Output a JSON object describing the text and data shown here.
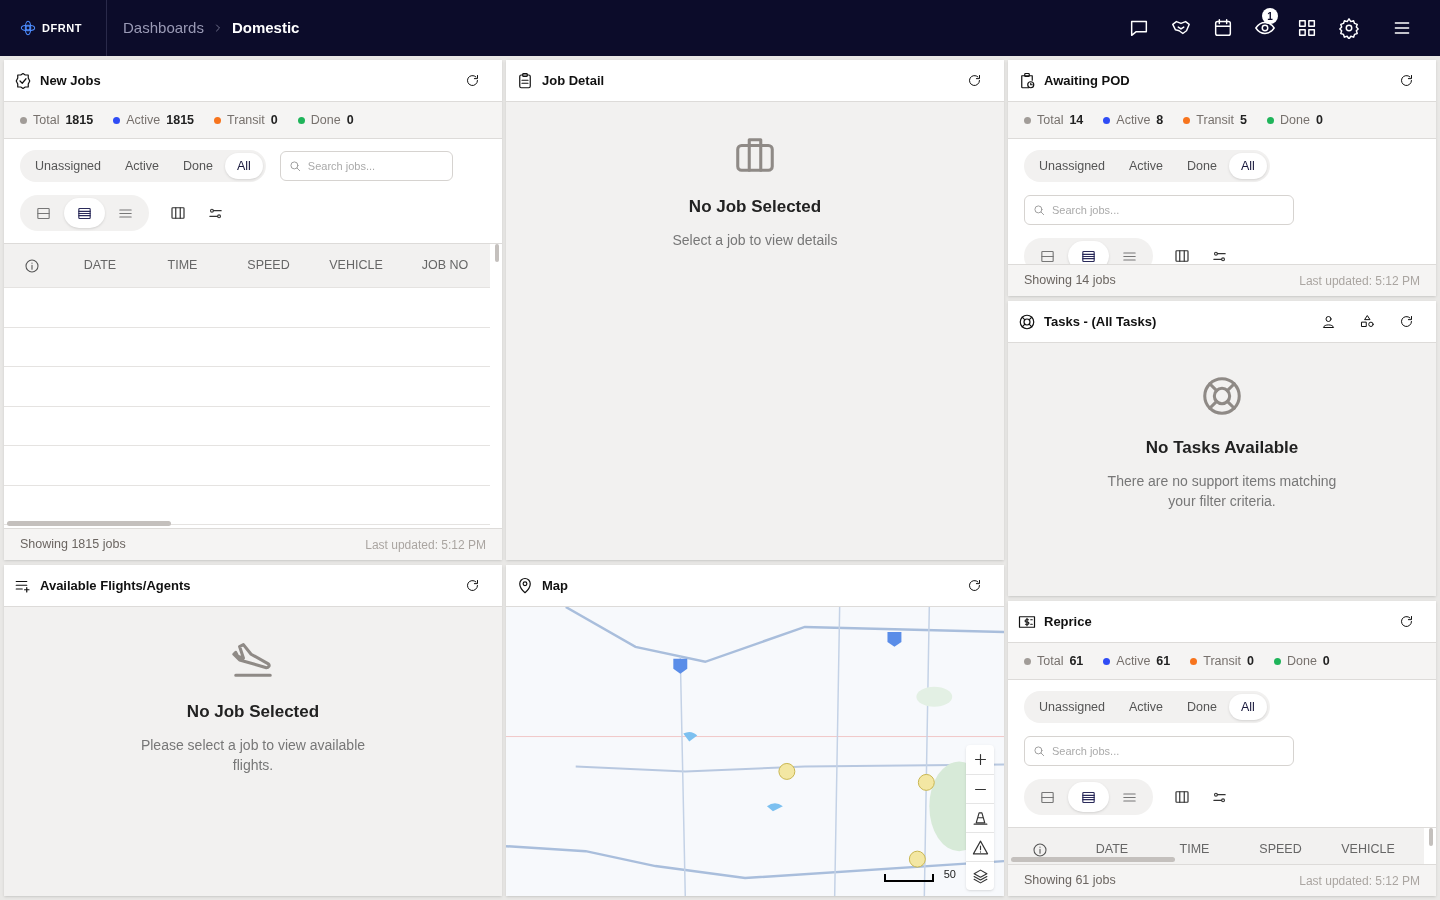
{
  "header": {
    "logo": "DFRNT",
    "breadcrumb": [
      {
        "label": "Dashboards",
        "current": false
      },
      {
        "label": "Domestic",
        "current": true
      }
    ],
    "notification_badge": "1"
  },
  "panels": [
    {
      "kind": "jobs",
      "title": "New Jobs",
      "stats": [
        {
          "label": "Total",
          "value": "1815",
          "color": "#a19c98"
        },
        {
          "label": "Active",
          "value": "1815",
          "color": "#2f4cf5"
        },
        {
          "label": "Transit",
          "value": "0",
          "color": "#f7741d"
        },
        {
          "label": "Done",
          "value": "0",
          "color": "#1fb45a"
        }
      ],
      "tabs": [
        {
          "label": "Unassigned",
          "selected": false
        },
        {
          "label": "Active",
          "selected": false
        },
        {
          "label": "Done",
          "selected": false
        },
        {
          "label": "All",
          "selected": true
        }
      ],
      "search": {
        "placeholder": "Search jobs..."
      },
      "view_modes": [
        {
          "selected": false
        },
        {
          "selected": true
        },
        {
          "selected": false
        }
      ],
      "table": {
        "columns": [
          "DATE",
          "TIME",
          "SPEED",
          "VEHICLE",
          "JOB NO"
        ]
      },
      "footer": {
        "count": "Showing 1815 jobs",
        "updated": "Last updated: 5:12 PM"
      }
    },
    {
      "kind": "empty",
      "title": "Job Detail",
      "heading": "No Job Selected",
      "message": "Select a job to view details"
    },
    {
      "kind": "jobs",
      "title": "Awaiting POD",
      "stats": [
        {
          "label": "Total",
          "value": "14",
          "color": "#a19c98"
        },
        {
          "label": "Active",
          "value": "8",
          "color": "#2f4cf5"
        },
        {
          "label": "Transit",
          "value": "5",
          "color": "#f7741d"
        },
        {
          "label": "Done",
          "value": "0",
          "color": "#1fb45a"
        }
      ],
      "tabs": [
        {
          "label": "Unassigned",
          "selected": false
        },
        {
          "label": "Active",
          "selected": false
        },
        {
          "label": "Done",
          "selected": false
        },
        {
          "label": "All",
          "selected": true
        }
      ],
      "search": {
        "placeholder": "Search jobs..."
      },
      "view_modes": [
        {
          "selected": false
        },
        {
          "selected": true
        },
        {
          "selected": false
        }
      ],
      "footer": {
        "count": "Showing 14 jobs",
        "updated": "Last updated: 5:12 PM"
      }
    },
    {
      "kind": "empty",
      "title": "Tasks - (All Tasks)",
      "heading": "No Tasks Available",
      "message": "There are no support items matching your filter criteria."
    },
    {
      "kind": "empty",
      "title": "Available Flights/Agents",
      "heading": "No Job Selected",
      "message": "Please select a job to view available flights."
    },
    {
      "kind": "map",
      "title": "Map",
      "scale": "50"
    },
    {
      "kind": "jobs",
      "title": "Reprice",
      "stats": [
        {
          "label": "Total",
          "value": "61",
          "color": "#a19c98"
        },
        {
          "label": "Active",
          "value": "61",
          "color": "#2f4cf5"
        },
        {
          "label": "Transit",
          "value": "0",
          "color": "#f7741d"
        },
        {
          "label": "Done",
          "value": "0",
          "color": "#1fb45a"
        }
      ],
      "tabs": [
        {
          "label": "Unassigned",
          "selected": false
        },
        {
          "label": "Active",
          "selected": false
        },
        {
          "label": "Done",
          "selected": false
        },
        {
          "label": "All",
          "selected": true
        }
      ],
      "search": {
        "placeholder": "Search jobs..."
      },
      "view_modes": [
        {
          "selected": false
        },
        {
          "selected": true
        },
        {
          "selected": false
        }
      ],
      "table": {
        "columns": [
          "DATE",
          "TIME",
          "SPEED",
          "VEHICLE"
        ]
      },
      "footer": {
        "count": "Showing 61 jobs",
        "updated": "Last updated: 5:12 PM"
      }
    }
  ]
}
